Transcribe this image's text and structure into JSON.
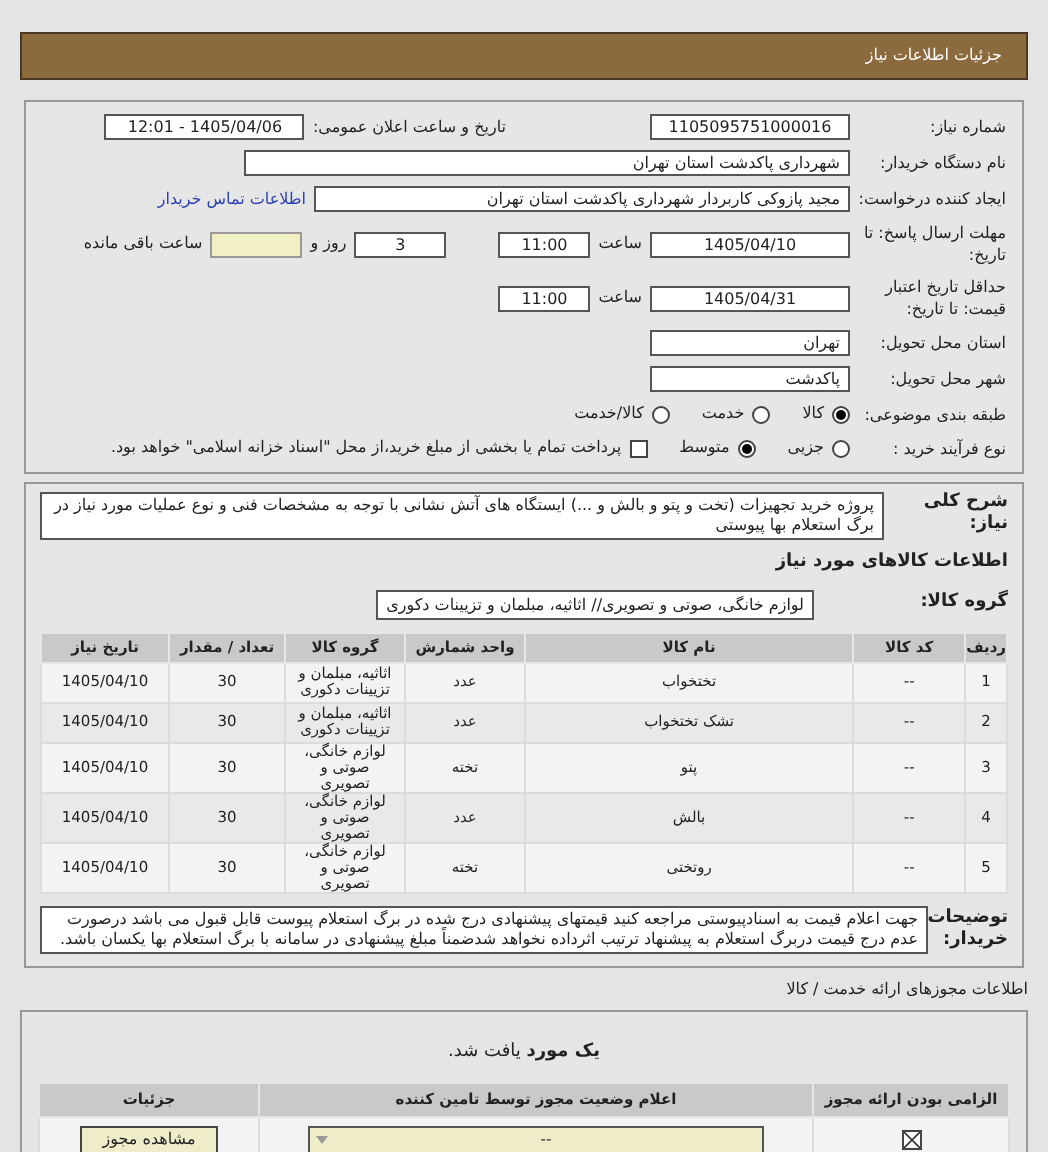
{
  "header": {
    "title": "جزئیات اطلاعات نیاز"
  },
  "need_number": {
    "label": "شماره نیاز:",
    "value": "1105095751000016"
  },
  "announce": {
    "label": "تاریخ و ساعت اعلان عمومی:",
    "value": "1405/04/06 - 12:01"
  },
  "buyer": {
    "label": "نام دستگاه خریدار:",
    "value": "شهرداری پاکدشت استان تهران"
  },
  "requester": {
    "label": "ایجاد کننده درخواست:",
    "value": "مجید پازوکی کاربردار شهرداری پاکدشت استان تهران",
    "link": "اطلاعات تماس خریدار"
  },
  "deadline": {
    "label": "مهلت ارسال پاسخ: تا تاریخ:",
    "date": "1405/04/10",
    "time_label": "ساعت",
    "time": "11:00",
    "days": "3",
    "days_label": "روز و",
    "remaining_label": "ساعت باقی مانده"
  },
  "validity": {
    "label": "حداقل تاریخ اعتبار قیمت: تا تاریخ:",
    "date": "1405/04/31",
    "time_label": "ساعت",
    "time": "11:00"
  },
  "province": {
    "label": "استان محل تحویل:",
    "value": "تهران"
  },
  "city": {
    "label": "شهر محل تحویل:",
    "value": "پاکدشت"
  },
  "category": {
    "label": "طبقه بندی موضوعی:",
    "options": [
      {
        "label": "کالا",
        "selected": true
      },
      {
        "label": "خدمت",
        "selected": false
      },
      {
        "label": "کالا/خدمت",
        "selected": false
      }
    ]
  },
  "process": {
    "label": "نوع فرآیند خرید :",
    "options": [
      {
        "label": "جزیی",
        "selected": false
      },
      {
        "label": "متوسط",
        "selected": true
      }
    ],
    "payment": {
      "checked": false,
      "text": "پرداخت تمام یا بخشی از مبلغ خرید،از محل \"اسناد خزانه اسلامی\" خواهد بود."
    }
  },
  "description": {
    "label": "شرح کلی نیاز:",
    "value": "پروژه خرید تجهیزات (تخت و پتو و بالش و ...) ایستگاه های آتش نشانی با توجه به مشخصات فنی و نوع عملیات مورد نیاز در برگ استعلام بها پیوستی"
  },
  "goods_title": "اطلاعات کالاهای مورد نیاز",
  "group": {
    "label": "گروه کالا:",
    "value": "لوازم خانگی، صوتی و تصویری// اثاثیه، مبلمان و تزیینات دکوری"
  },
  "goods_table": {
    "columns": [
      "ردیف",
      "کد کالا",
      "نام کالا",
      "واحد شمارش",
      "گروه کالا",
      "تعداد / مقدار",
      "تاریخ نیاز"
    ],
    "rows": [
      [
        "1",
        "--",
        "تختخواب",
        "عدد",
        "اثاثیه، مبلمان و تزیینات دکوری",
        "30",
        "1405/04/10"
      ],
      [
        "2",
        "--",
        "تشک تختخواب",
        "عدد",
        "اثاثیه، مبلمان و تزیینات دکوری",
        "30",
        "1405/04/10"
      ],
      [
        "3",
        "--",
        "پتو",
        "تخته",
        "لوازم خانگی، صوتی و تصویری",
        "30",
        "1405/04/10"
      ],
      [
        "4",
        "--",
        "بالش",
        "عدد",
        "لوازم خانگی، صوتی و تصویری",
        "30",
        "1405/04/10"
      ],
      [
        "5",
        "--",
        "روتختی",
        "تخته",
        "لوازم خانگی، صوتی و تصویری",
        "30",
        "1405/04/10"
      ]
    ]
  },
  "buyer_notes": {
    "label": "توضیحات خریدار:",
    "value": "جهت اعلام قیمت به اسنادپیوستی مراجعه کنید قیمتهای پیشنهادی درج شده در برگ استعلام پیوست قابل قبول می باشد درصورت عدم درج قیمت دربرگ استعلام به پیشنهاد ترتیب اثرداده نخواهد شدضمناً مبلغ پیشنهادی در سامانه با برگ استعلام بها یکسان باشد."
  },
  "permits": {
    "title": "اطلاعات مجوزهای ارائه خدمت / کالا",
    "found": "**یک مورد** یافت شد.",
    "columns": [
      "الزامی بودن ارائه مجوز",
      "اعلام وضعیت مجوز توسط تامین کننده",
      "جزئیات"
    ],
    "rows": [
      {
        "required": true,
        "status": "--",
        "button": "مشاهده مجوز"
      }
    ]
  }
}
